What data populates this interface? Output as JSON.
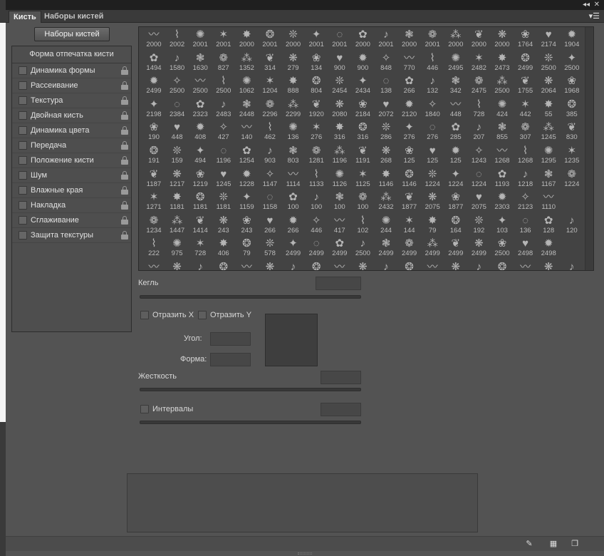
{
  "tabs": [
    {
      "label": "Кисть",
      "active": true
    },
    {
      "label": "Наборы кистей",
      "active": false
    }
  ],
  "preset_button": "Наборы кистей",
  "left_panel": {
    "header": "Форма отпечатка кисти",
    "items": [
      "Динамика формы",
      "Рассеивание",
      "Текстура",
      "Двойная кисть",
      "Динамика цвета",
      "Передача",
      "Положение кисти",
      "Шум",
      "Влажные края",
      "Накладка",
      "Сглаживание",
      "Защита текстуры"
    ]
  },
  "brush_grid": {
    "columns": 19,
    "rows": [
      [
        "2000",
        "2002",
        "2001",
        "2001",
        "2000",
        "2001",
        "2000",
        "2001",
        "2001",
        "2000",
        "2001",
        "2000",
        "2001",
        "2000",
        "2000",
        "2000",
        "1764",
        "2174",
        "1904"
      ],
      [
        "1494",
        "1580",
        "1630",
        "827",
        "1352",
        "314",
        "279",
        "134",
        "900",
        "900",
        "848",
        "770",
        "446",
        "2495",
        "2482",
        "2473",
        "2499",
        "2500",
        "2500"
      ],
      [
        "2499",
        "2500",
        "2500",
        "2500",
        "1062",
        "1204",
        "888",
        "804",
        "2454",
        "2434",
        "138",
        "266",
        "132",
        "342",
        "2475",
        "2500",
        "1755",
        "2064",
        "1968"
      ],
      [
        "2198",
        "2384",
        "2323",
        "2483",
        "2448",
        "2296",
        "2299",
        "1920",
        "2080",
        "2184",
        "2072",
        "2120",
        "1840",
        "448",
        "728",
        "424",
        "442",
        "55",
        "385"
      ],
      [
        "190",
        "448",
        "408",
        "427",
        "140",
        "462",
        "136",
        "276",
        "316",
        "316",
        "286",
        "276",
        "276",
        "285",
        "207",
        "855",
        "307",
        "1245",
        "830"
      ],
      [
        "191",
        "159",
        "494",
        "1196",
        "1254",
        "903",
        "803",
        "1281",
        "1196",
        "1191",
        "268",
        "125",
        "125",
        "125",
        "1243",
        "1268",
        "1268",
        "1295",
        "1235"
      ],
      [
        "1187",
        "1217",
        "1219",
        "1245",
        "1228",
        "1147",
        "1114",
        "1133",
        "1126",
        "1125",
        "1146",
        "1146",
        "1224",
        "1224",
        "1224",
        "1193",
        "1218",
        "1167",
        "1224"
      ],
      [
        "1271",
        "1181",
        "1181",
        "1181",
        "1159",
        "1158",
        "100",
        "100",
        "100",
        "100",
        "2432",
        "1877",
        "2075",
        "1877",
        "2075",
        "2303",
        "2123",
        "1110"
      ],
      [
        "1234",
        "1447",
        "1414",
        "243",
        "243",
        "266",
        "266",
        "446",
        "417",
        "102",
        "244",
        "144",
        "79",
        "164",
        "192",
        "103",
        "136",
        "128",
        "120"
      ],
      [
        "222",
        "975",
        "728",
        "406",
        "79",
        "578",
        "2499",
        "2499",
        "2499",
        "2500",
        "2499",
        "2499",
        "2499",
        "2499",
        "2499",
        "2500",
        "2498",
        "2498"
      ]
    ],
    "icons": [
      "brush-stroke",
      "brush-splash",
      "brush-leaf",
      "brush-grass",
      "brush-circle",
      "brush-star",
      "brush-music",
      "brush-heart",
      "brush-flower",
      "brush-swirl"
    ]
  },
  "size": {
    "label": "Кегль"
  },
  "flip_x": "Отразить X",
  "flip_y": "Отразить Y",
  "angle": {
    "label": "Угол:"
  },
  "roundness": {
    "label": "Форма:"
  },
  "hardness": {
    "label": "Жесткость"
  },
  "spacing": {
    "label": "Интервалы"
  }
}
